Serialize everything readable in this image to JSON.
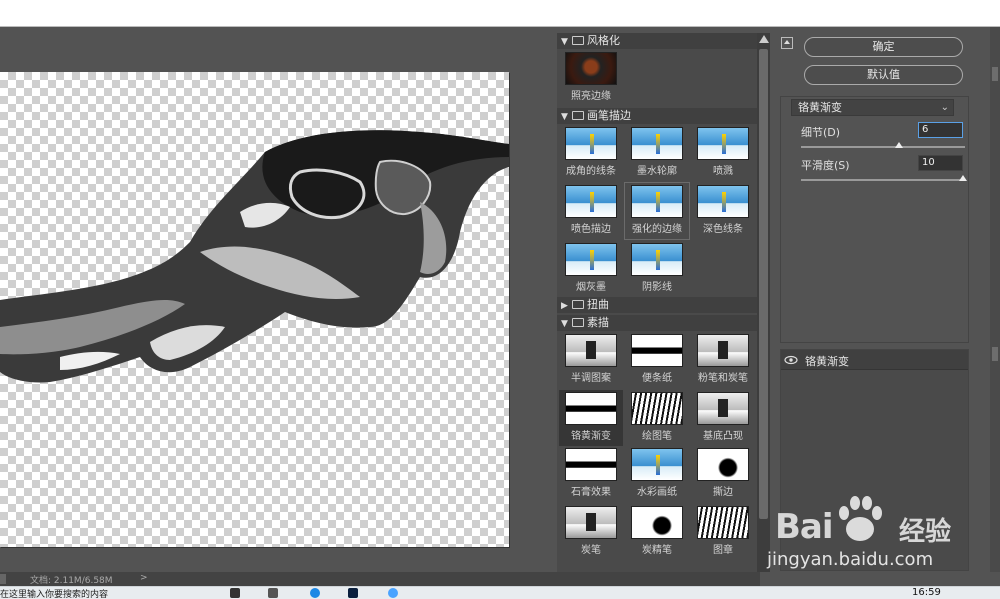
{
  "settings": {
    "ok_label": "确定",
    "default_label": "默认值",
    "filter_select": "铬黄渐变",
    "params": [
      {
        "label": "细节(D)",
        "value": "6",
        "level": 0.6
      },
      {
        "label": "平滑度(S)",
        "value": "10",
        "level": 1.0
      }
    ],
    "layer_name": "铬黄渐变"
  },
  "gallery": {
    "categories": [
      {
        "name": "风格化",
        "expanded": true,
        "filters": [
          "照亮边缘"
        ]
      },
      {
        "name": "画笔描边",
        "expanded": true,
        "filters": [
          "成角的线条",
          "墨水轮廓",
          "喷溅",
          "喷色描边",
          "强化的边缘",
          "深色线条",
          "烟灰墨",
          "阴影线"
        ]
      },
      {
        "name": "扭曲",
        "expanded": false,
        "filters": []
      },
      {
        "name": "素描",
        "expanded": true,
        "filters": [
          "半调图案",
          "便条纸",
          "粉笔和炭笔",
          "铬黄渐变",
          "绘图笔",
          "基底凸现",
          "石膏效果",
          "水彩画纸",
          "撕边",
          "炭笔",
          "炭精笔",
          "图章"
        ]
      }
    ],
    "selected_filter": "铬黄渐变"
  },
  "status": {
    "doc_info": "文档: 2.11M/6.58M",
    "arrow": ">"
  },
  "taskbar": {
    "left_text": "在这里输入你要搜索的内容",
    "time": "16:59"
  },
  "watermark": {
    "brand": "Bai",
    "brand2": "经验",
    "url": "jingyan.baidu.com"
  },
  "colors": {
    "panel_bg": "#535353",
    "gallery_bg": "#4a4a4a",
    "focus_border": "#5aa0e6"
  }
}
